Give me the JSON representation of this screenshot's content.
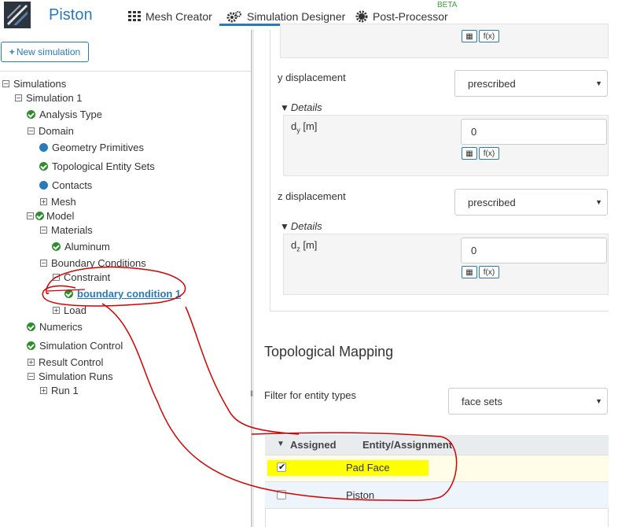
{
  "header": {
    "app_name": "Piston",
    "nav": [
      {
        "label": "Mesh Creator",
        "icon": "grid-icon"
      },
      {
        "label": "Simulation Designer",
        "icon": "gears-icon"
      },
      {
        "label": "Post-Processor",
        "icon": "gear-icon"
      }
    ],
    "beta_badge": "BETA"
  },
  "sidebar": {
    "new_simulation": "New simulation",
    "tree": {
      "simulations": "Simulations",
      "simulation_1": "Simulation 1",
      "analysis_type": "Analysis Type",
      "domain": "Domain",
      "geometry_primitives": "Geometry Primitives",
      "topological_entity_sets": "Topological Entity Sets",
      "contacts": "Contacts",
      "mesh": "Mesh",
      "model": "Model",
      "materials": "Materials",
      "aluminum": "Aluminum",
      "boundary_conditions": "Boundary Conditions",
      "constraint": "Constraint",
      "boundary_condition_1": "boundary condition 1",
      "load": "Load",
      "numerics": "Numerics",
      "simulation_control": "Simulation Control",
      "result_control": "Result Control",
      "simulation_runs": "Simulation Runs",
      "run_1": "Run 1"
    }
  },
  "main": {
    "y_displacement": {
      "label": "y displacement",
      "value": "prescribed",
      "details": "Details",
      "field_base": "d",
      "field_sub": "y",
      "field_unit": "[m]",
      "field_value": "0"
    },
    "z_displacement": {
      "label": "z displacement",
      "value": "prescribed",
      "details": "Details",
      "field_base": "d",
      "field_sub": "z",
      "field_unit": "[m]",
      "field_value": "0"
    },
    "table_button": "▦",
    "fx_button": "f(x)",
    "topological_mapping": {
      "title": "Topological Mapping",
      "filter_label": "Filter for entity types",
      "filter_value": "face sets",
      "columns": {
        "assigned": "Assigned",
        "entity": "Entity/Assignment"
      },
      "rows": [
        {
          "entity": "Pad Face",
          "assigned": true
        },
        {
          "entity": "Piston",
          "assigned": false
        }
      ]
    }
  },
  "colors": {
    "accent": "#2a7ab8",
    "check_green": "#2e8b2e",
    "highlight": "#ffff00",
    "annotation": "#cc0000"
  }
}
